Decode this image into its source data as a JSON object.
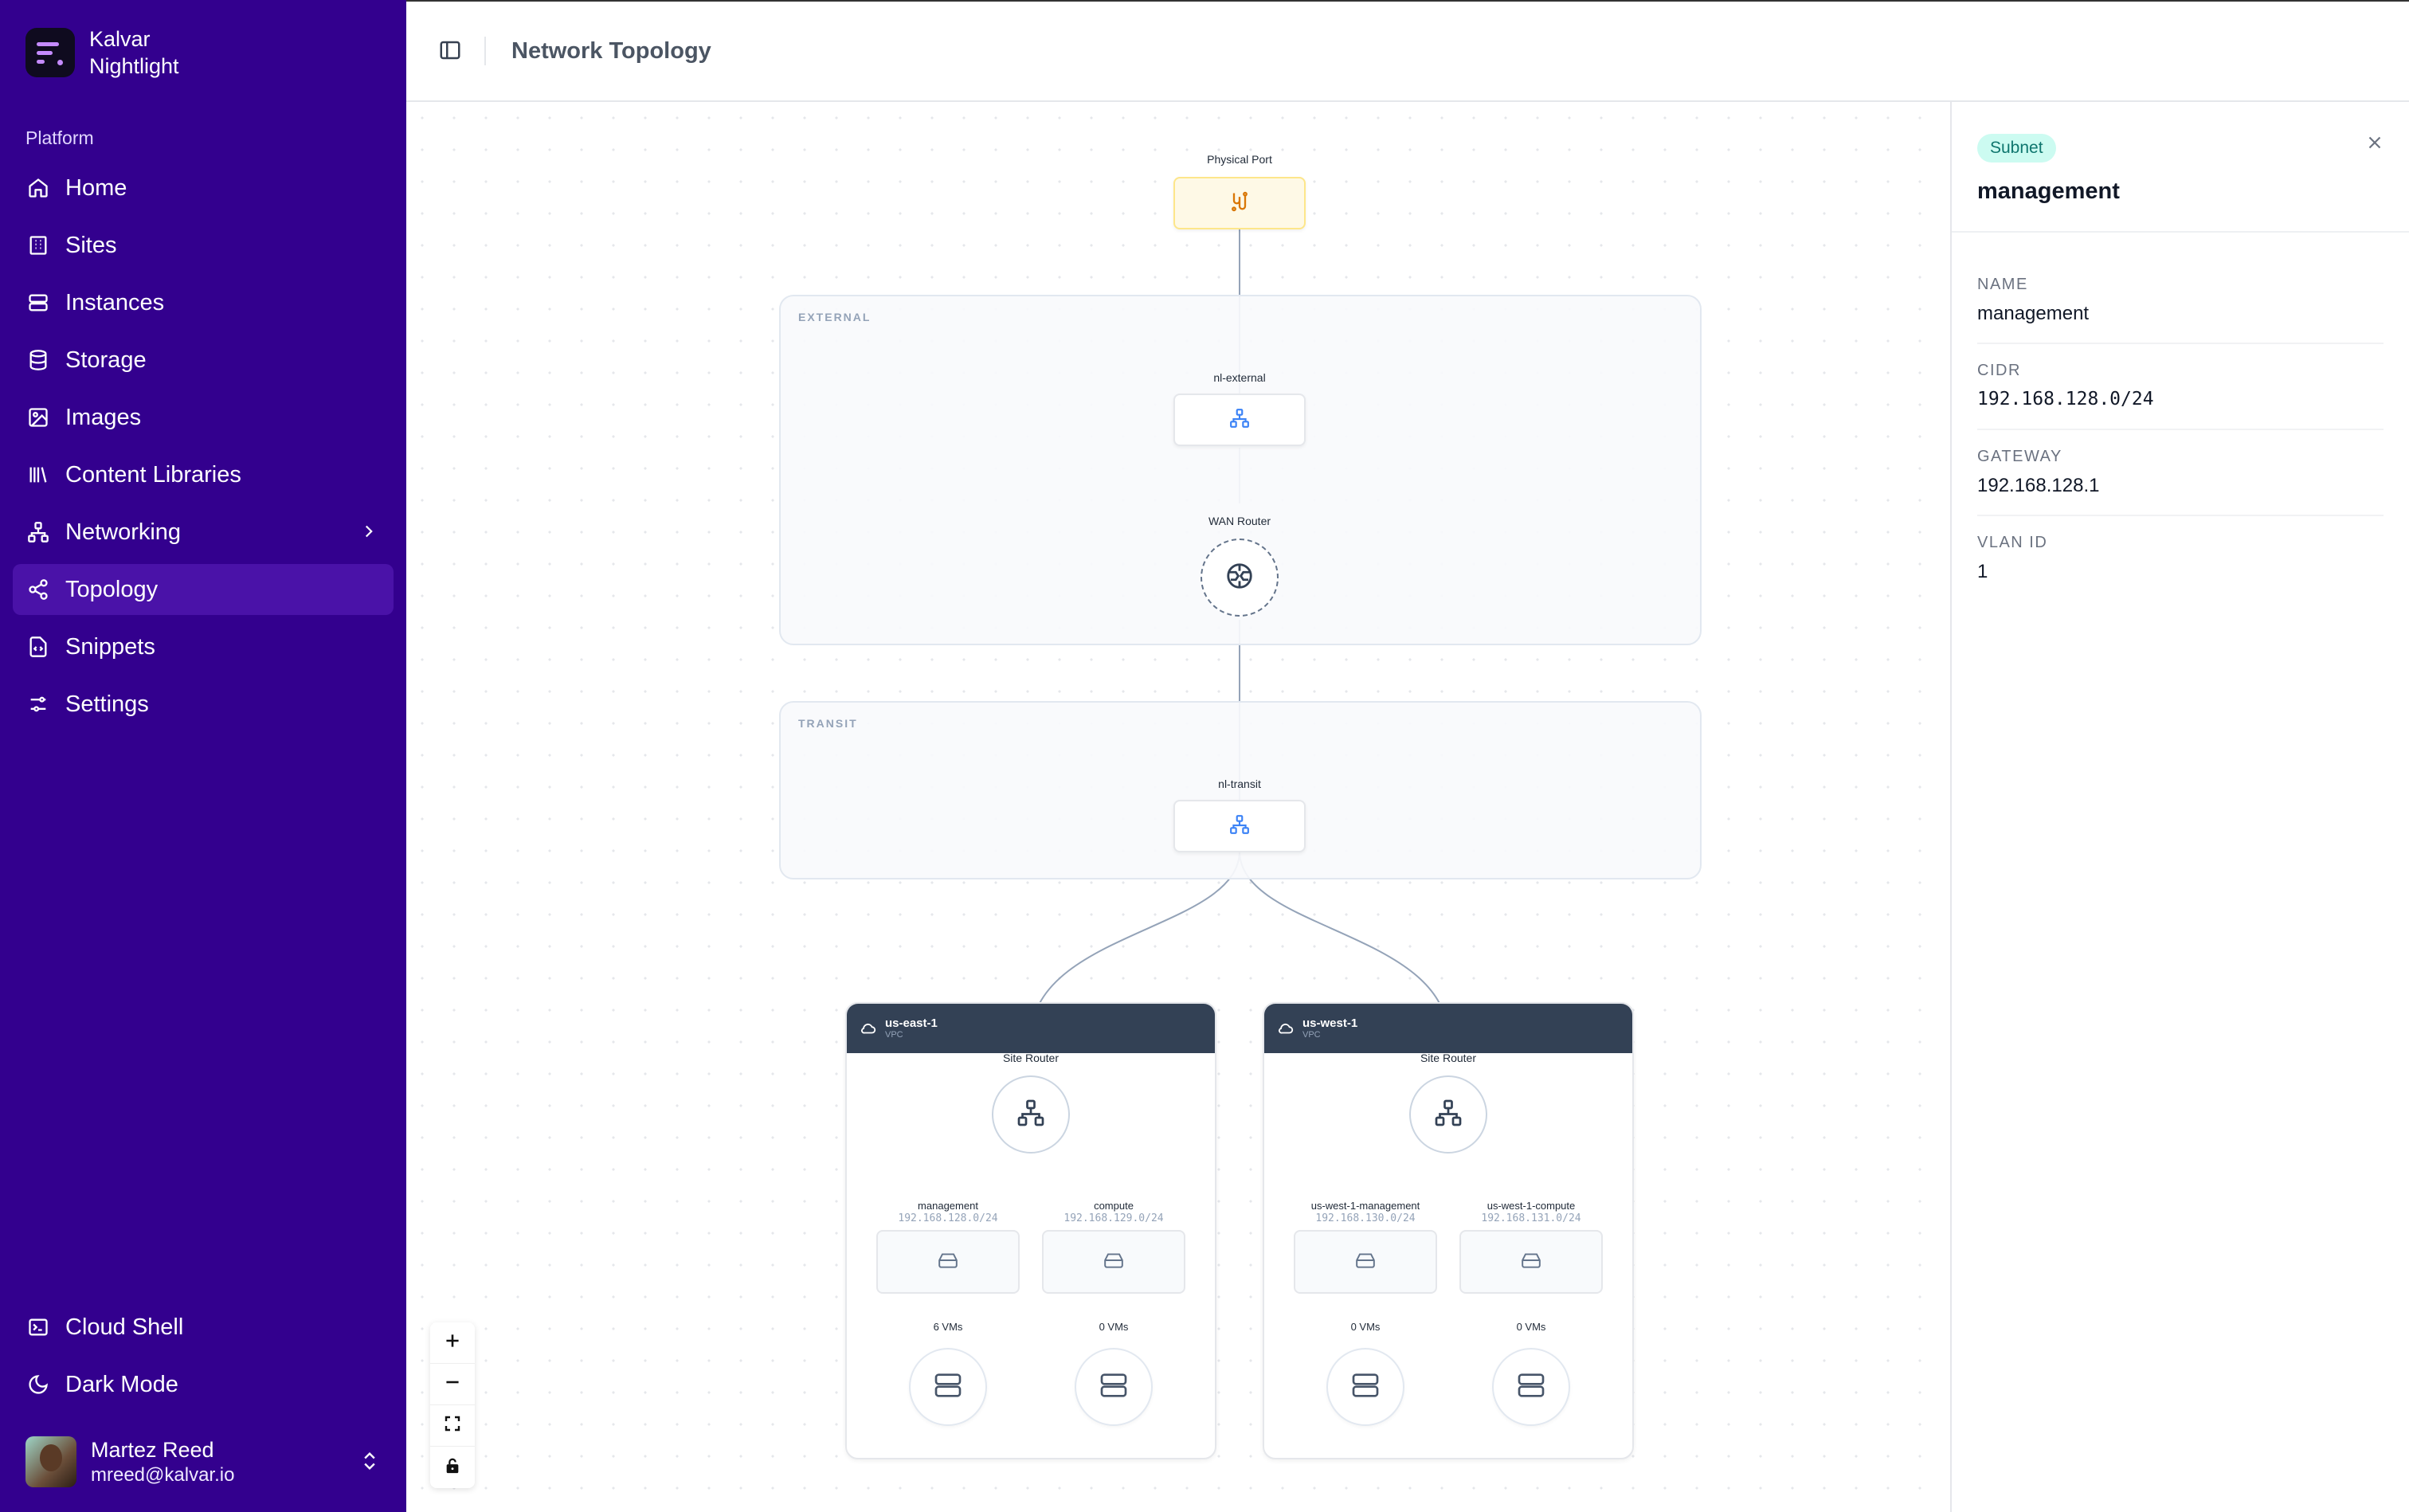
{
  "brand": {
    "name": "Kalvar",
    "product": "Nightlight"
  },
  "sidebar": {
    "section_label": "Platform",
    "items": [
      {
        "label": "Home",
        "icon": "home-icon"
      },
      {
        "label": "Sites",
        "icon": "building-icon"
      },
      {
        "label": "Instances",
        "icon": "server-icon"
      },
      {
        "label": "Storage",
        "icon": "database-icon"
      },
      {
        "label": "Images",
        "icon": "image-icon"
      },
      {
        "label": "Content Libraries",
        "icon": "library-icon"
      },
      {
        "label": "Networking",
        "icon": "network-icon"
      },
      {
        "label": "Topology",
        "icon": "share-icon",
        "active": true
      },
      {
        "label": "Snippets",
        "icon": "snippet-icon"
      },
      {
        "label": "Settings",
        "icon": "sliders-icon"
      }
    ],
    "bottom_items": [
      {
        "label": "Cloud Shell",
        "icon": "terminal-icon"
      },
      {
        "label": "Dark Mode",
        "icon": "moon-icon"
      }
    ],
    "user": {
      "name": "Martez Reed",
      "email": "mreed@kalvar.io"
    }
  },
  "header": {
    "title": "Network Topology"
  },
  "topology": {
    "physical_port": {
      "label": "Physical Port"
    },
    "external_group": {
      "label": "EXTERNAL",
      "network": "nl-external",
      "router": "WAN Router"
    },
    "transit_group": {
      "label": "TRANSIT",
      "network": "nl-transit"
    },
    "vpcs": [
      {
        "name": "us-east-1",
        "type": "VPC",
        "router": "Site Router",
        "subnets": [
          {
            "name": "management",
            "cidr": "192.168.128.0/24",
            "vms": "6 VMs"
          },
          {
            "name": "compute",
            "cidr": "192.168.129.0/24",
            "vms": "0 VMs"
          }
        ]
      },
      {
        "name": "us-west-1",
        "type": "VPC",
        "router": "Site Router",
        "subnets": [
          {
            "name": "us-west-1-management",
            "cidr": "192.168.130.0/24",
            "vms": "0 VMs"
          },
          {
            "name": "us-west-1-compute",
            "cidr": "192.168.131.0/24",
            "vms": "0 VMs"
          }
        ]
      }
    ]
  },
  "panel": {
    "badge": "Subnet",
    "title": "management",
    "props": [
      {
        "key": "NAME",
        "value": "management"
      },
      {
        "key": "CIDR",
        "value": "192.168.128.0/24"
      },
      {
        "key": "GATEWAY",
        "value": "192.168.128.1"
      },
      {
        "key": "VLAN ID",
        "value": "1"
      }
    ]
  },
  "colors": {
    "sidebar_bg": "#33008e",
    "sidebar_active": "#4a12a8",
    "vpc_header": "#334155",
    "badge_bg": "#ccfbf1",
    "badge_text": "#0f766e",
    "port_bg": "#fef9e6",
    "link_blue": "#3b82f6"
  }
}
